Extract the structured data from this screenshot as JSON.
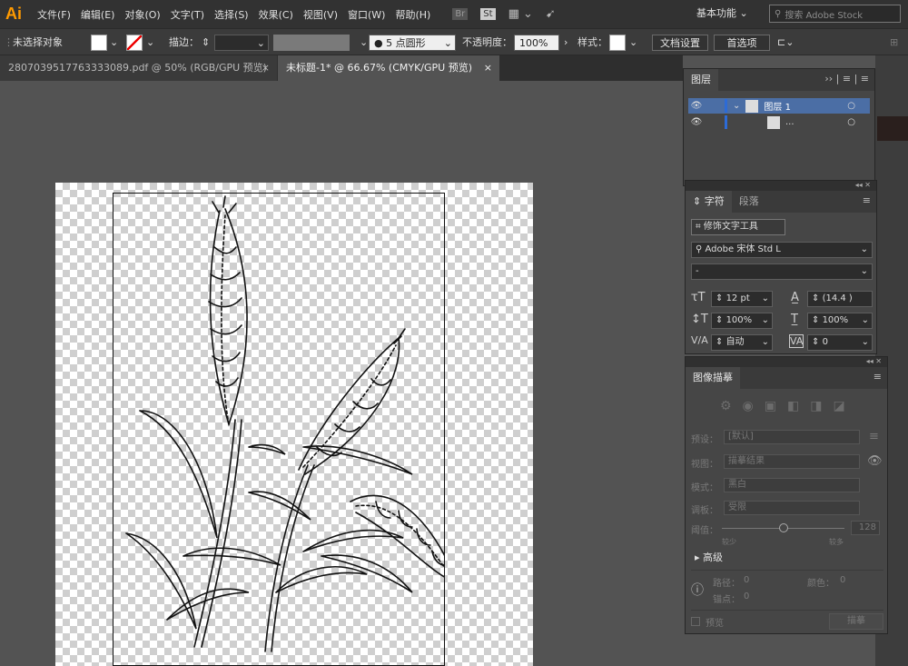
{
  "app": {
    "logo": "Ai"
  },
  "menubar": {
    "items": [
      "文件(F)",
      "编辑(E)",
      "对象(O)",
      "文字(T)",
      "选择(S)",
      "效果(C)",
      "视图(V)",
      "窗口(W)",
      "帮助(H)"
    ],
    "bridge": "Br",
    "stock": "St",
    "workspace": "基本功能",
    "search_placeholder": "搜索 Adobe Stock"
  },
  "controlbar": {
    "selection_status": "未选择对象",
    "stroke_label": "描边：",
    "brush_value": "5 点圆形",
    "opacity_label": "不透明度：",
    "opacity_value": "100%",
    "style_label": "样式：",
    "doc_setup": "文档设置",
    "preferences": "首选项"
  },
  "tabs": [
    {
      "label": "2807039517763333089.pdf @ 50% (RGB/GPU 预览)",
      "close": "×",
      "active": false
    },
    {
      "label": "未标题-1* @ 66.67% (CMYK/GPU 预览)",
      "close": "×",
      "active": true
    }
  ],
  "layers_panel": {
    "title": "图层",
    "layers": [
      {
        "name": "图层 1"
      },
      {
        "name": "..."
      }
    ]
  },
  "char_panel": {
    "tab_char": "字符",
    "tab_para": "段落",
    "touch_type": "修饰文字工具",
    "font_family": "Adobe 宋体 Std L",
    "font_style": "-",
    "size": "12 pt",
    "leading": "(14.4 )",
    "vscale": "100%",
    "hscale": "100%",
    "kerning": "自动",
    "tracking": "0"
  },
  "trace_panel": {
    "title": "图像描摹",
    "preset_label": "预设：",
    "preset_value": "[默认]",
    "view_label": "视图：",
    "view_value": "描摹结果",
    "mode_label": "模式：",
    "mode_value": "黑白",
    "palette_label": "调板：",
    "palette_value": "受限",
    "threshold_label": "阈值：",
    "threshold_value": "128",
    "threshold_level": 0.5,
    "less": "较少",
    "more": "较多",
    "advanced": "高级",
    "paths_label": "路径：",
    "paths_value": "0",
    "colors_label": "颜色：",
    "colors_value": "0",
    "anchors_label": "锚点：",
    "anchors_value": "0",
    "preview": "预览",
    "trace_button": "描摹"
  },
  "colors": {
    "accent": "#ff9a00",
    "selection": "#4b6ea5",
    "panel": "#464646"
  }
}
